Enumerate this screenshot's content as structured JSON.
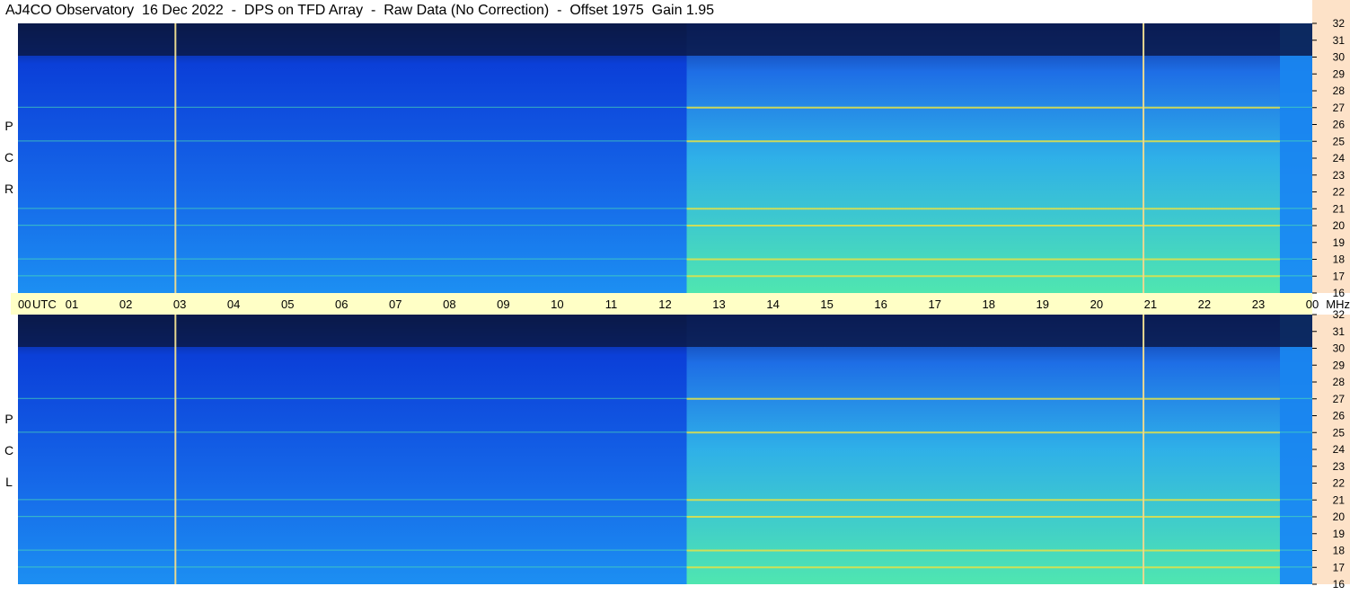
{
  "title": "AJ4CO Observatory  16 Dec 2022  -  DPS on TFD Array  -  Raw Data (No Correction)  -  Offset 1975  Gain 1.95",
  "colors": {
    "background": "#ffffff",
    "time_axis_bg": "#ffffc6",
    "freq_axis_bg": "#fde2c8",
    "night_sky": "#0a1a4a",
    "spectrum_low": "#0b3fd8",
    "spectrum_mid": "#1c8ff2",
    "spectrum_high": "#4fe6b0",
    "interference": "#f0e040",
    "marker_line": "#e8d890"
  },
  "chart_data": {
    "type": "heatmap",
    "panels": [
      {
        "name": "R C P",
        "letters": [
          "P",
          "C",
          "R"
        ]
      },
      {
        "name": "L C P",
        "letters": [
          "P",
          "C",
          "L"
        ]
      }
    ],
    "x_axis": {
      "unit": "UTC",
      "ticks": [
        "00",
        "01",
        "02",
        "03",
        "04",
        "05",
        "06",
        "07",
        "08",
        "09",
        "10",
        "11",
        "12",
        "13",
        "14",
        "15",
        "16",
        "17",
        "18",
        "19",
        "20",
        "21",
        "22",
        "23",
        "00"
      ],
      "range": [
        0,
        24
      ]
    },
    "y_axis": {
      "unit": "MHz",
      "ticks": [
        16,
        17,
        18,
        19,
        20,
        21,
        22,
        23,
        24,
        25,
        26,
        27,
        28,
        29,
        30,
        31,
        32
      ],
      "range": [
        16,
        32
      ]
    },
    "sunrise_utc": 12.4,
    "sunset_utc": 23.4,
    "vertical_markers_utc": [
      2.92,
      20.87
    ],
    "interference_bands_mhz": [
      17.0,
      18.0,
      20.0,
      21.0,
      25.0,
      27.0
    ]
  }
}
